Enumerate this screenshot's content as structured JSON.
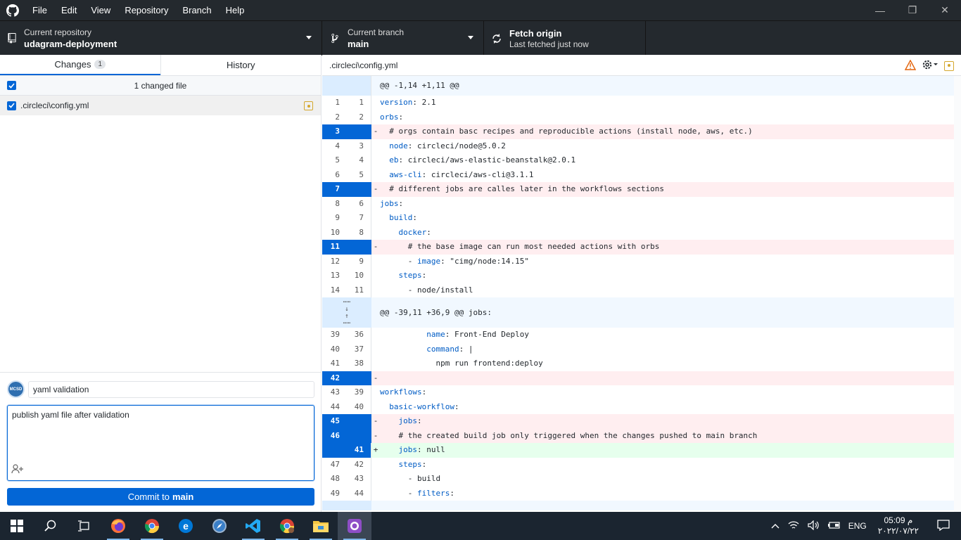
{
  "menubar": {
    "items": [
      "File",
      "Edit",
      "View",
      "Repository",
      "Branch",
      "Help"
    ]
  },
  "toolbar": {
    "repo_label": "Current repository",
    "repo_value": "udagram-deployment",
    "branch_label": "Current branch",
    "branch_value": "main",
    "fetch_label": "Fetch origin",
    "fetch_sub": "Last fetched just now"
  },
  "tabs": {
    "changes": "Changes",
    "changes_count": "1",
    "history": "History"
  },
  "changes": {
    "header": "1 changed file",
    "file": ".circleci\\config.yml"
  },
  "commit": {
    "summary": "yaml validation",
    "description": "publish yaml file after validation",
    "button_prefix": "Commit to",
    "button_branch": "main",
    "avatar_text": "MCSD"
  },
  "diff": {
    "path": ".circleci\\config.yml",
    "hunk1": "@@ -1,14 +1,11 @@",
    "hunk2": "@@ -39,11 +36,9 @@ jobs:",
    "lines1": [
      {
        "o": "1",
        "n": "1",
        "t": "ctx",
        "m": "",
        "c": "version: 2.1"
      },
      {
        "o": "2",
        "n": "2",
        "t": "ctx",
        "m": "",
        "c": "orbs:"
      },
      {
        "o": "3",
        "n": "",
        "t": "del",
        "m": "-",
        "c": "  # orgs contain basc recipes and reproducible actions (install node, aws, etc.)"
      },
      {
        "o": "4",
        "n": "3",
        "t": "ctx",
        "m": "",
        "c": "  node: circleci/node@5.0.2"
      },
      {
        "o": "5",
        "n": "4",
        "t": "ctx",
        "m": "",
        "c": "  eb: circleci/aws-elastic-beanstalk@2.0.1"
      },
      {
        "o": "6",
        "n": "5",
        "t": "ctx",
        "m": "",
        "c": "  aws-cli: circleci/aws-cli@3.1.1"
      },
      {
        "o": "7",
        "n": "",
        "t": "del",
        "m": "-",
        "c": "  # different jobs are calles later in the workflows sections"
      },
      {
        "o": "8",
        "n": "6",
        "t": "ctx",
        "m": "",
        "c": "jobs:"
      },
      {
        "o": "9",
        "n": "7",
        "t": "ctx",
        "m": "",
        "c": "  build:"
      },
      {
        "o": "10",
        "n": "8",
        "t": "ctx",
        "m": "",
        "c": "    docker:"
      },
      {
        "o": "11",
        "n": "",
        "t": "del",
        "m": "-",
        "c": "      # the base image can run most needed actions with orbs"
      },
      {
        "o": "12",
        "n": "9",
        "t": "ctx",
        "m": "",
        "c": "      - image: \"cimg/node:14.15\""
      },
      {
        "o": "13",
        "n": "10",
        "t": "ctx",
        "m": "",
        "c": "    steps:"
      },
      {
        "o": "14",
        "n": "11",
        "t": "ctx",
        "m": "",
        "c": "      - node/install"
      }
    ],
    "lines2": [
      {
        "o": "39",
        "n": "36",
        "t": "ctx",
        "m": "",
        "c": "          name: Front-End Deploy"
      },
      {
        "o": "40",
        "n": "37",
        "t": "ctx",
        "m": "",
        "c": "          command: |"
      },
      {
        "o": "41",
        "n": "38",
        "t": "ctx",
        "m": "",
        "c": "            npm run frontend:deploy"
      },
      {
        "o": "42",
        "n": "",
        "t": "del",
        "m": "-",
        "c": ""
      },
      {
        "o": "43",
        "n": "39",
        "t": "ctx",
        "m": "",
        "c": "workflows:"
      },
      {
        "o": "44",
        "n": "40",
        "t": "ctx",
        "m": "",
        "c": "  basic-workflow:"
      },
      {
        "o": "45",
        "n": "",
        "t": "del",
        "m": "-",
        "c": "    jobs:"
      },
      {
        "o": "46",
        "n": "",
        "t": "del",
        "m": "-",
        "c": "    # the created build job only triggered when the changes pushed to main branch"
      },
      {
        "o": "",
        "n": "41",
        "t": "add",
        "m": "+",
        "c": "    jobs: null"
      },
      {
        "o": "47",
        "n": "42",
        "t": "ctx",
        "m": "",
        "c": "    steps:"
      },
      {
        "o": "48",
        "n": "43",
        "t": "ctx",
        "m": "",
        "c": "      - build"
      },
      {
        "o": "49",
        "n": "44",
        "t": "ctx",
        "m": "",
        "c": "      - filters:"
      }
    ]
  },
  "taskbar": {
    "lang": "ENG",
    "time": "05:09 م",
    "date": "٢٠٢٢/٠٧/٢٢"
  },
  "colors": {
    "accent": "#0366d6",
    "titlebar": "#24292e",
    "taskbar": "#1b2530",
    "deletion": "#ffeef0",
    "addition": "#e6ffed"
  }
}
